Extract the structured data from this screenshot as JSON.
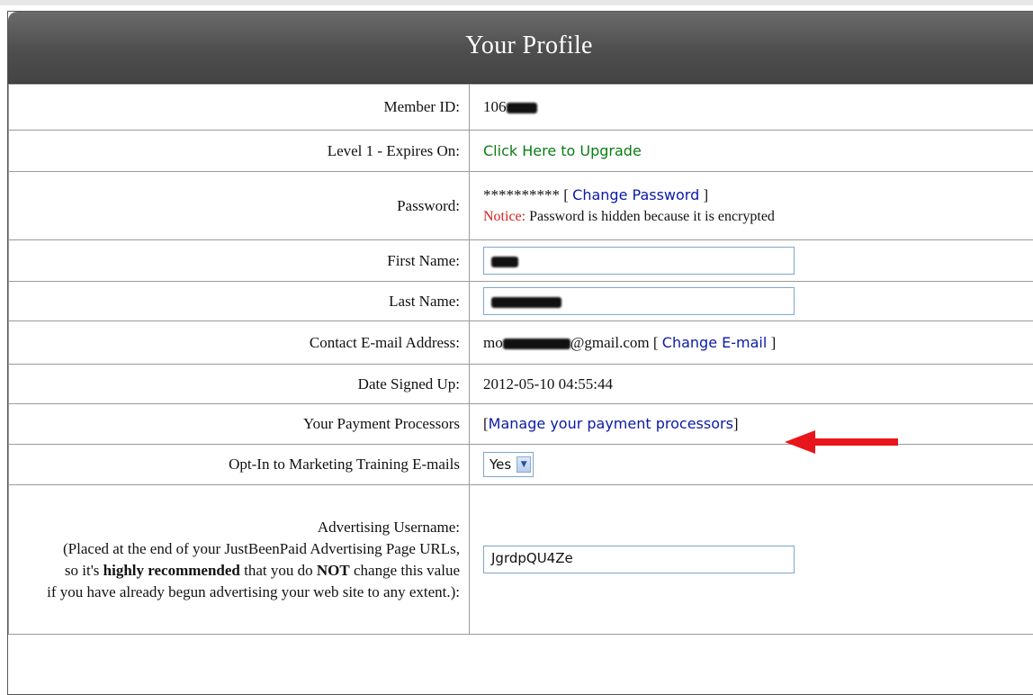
{
  "header": {
    "title": "Your Profile"
  },
  "rows": {
    "member_id": {
      "label": "Member ID:",
      "value": "106"
    },
    "level": {
      "label": "Level 1 - Expires On:",
      "link": "Click Here to Upgrade"
    },
    "password": {
      "label": "Password:",
      "masked": "**********",
      "open_bracket": "[",
      "link": "Change Password",
      "close_bracket": "]",
      "notice_label": "Notice:",
      "notice_text": "Password is hidden because it is encrypted"
    },
    "first_name": {
      "label": "First Name:"
    },
    "last_name": {
      "label": "Last Name:"
    },
    "email": {
      "label": "Contact E-mail Address:",
      "prefix": "mo",
      "domain": "@gmail.com",
      "open_bracket": "[",
      "link": "Change E-mail",
      "close_bracket": "]"
    },
    "date_signed": {
      "label": "Date Signed Up:",
      "value": "2012-05-10 04:55:44"
    },
    "payment": {
      "label": "Your Payment Processors",
      "open_bracket": "[",
      "link": "Manage your payment processors",
      "close_bracket": "]"
    },
    "optin": {
      "label": "Opt-In to Marketing Training E-mails",
      "selected": "Yes"
    },
    "advertising": {
      "label_title": "Advertising Username:",
      "note_line1": "(Placed at the end of your JustBeenPaid Advertising Page URLs,",
      "note_line2_a": "so it's ",
      "note_line2_bold": "highly recommended",
      "note_line2_b": " that you do ",
      "note_line2_not": "NOT",
      "note_line2_c": " change this value",
      "note_line3": "if you have already begun advertising your web site to any extent.):",
      "value": "JgrdpQU4Ze"
    }
  },
  "colors": {
    "annotation_arrow": "#e8161b",
    "link_green": "#0a7d12",
    "link_blue": "#0a1aa8",
    "notice": "#d51d1d"
  }
}
